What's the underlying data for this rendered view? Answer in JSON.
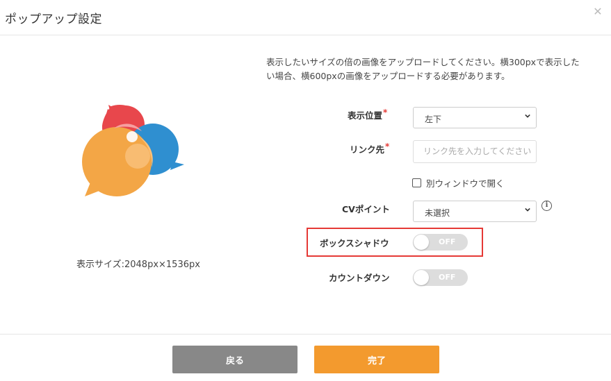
{
  "dialog": {
    "title": "ポップアップ設定",
    "close_icon": "close-icon"
  },
  "preview": {
    "size_text": "表示サイズ:2048px×1536px",
    "colors": {
      "red": "#e8474c",
      "blue": "#2f8fd0",
      "orange": "#f3a646",
      "overlap": "#f8c07a"
    }
  },
  "form": {
    "description": "表示したいサイズの倍の画像をアップロードしてください。横300pxで表示したい場合、横600pxの画像をアップロードする必要があります。",
    "required_mark": "*",
    "position": {
      "label": "表示位置",
      "value": "左下"
    },
    "link": {
      "label": "リンク先",
      "placeholder": "リンク先を入力してください"
    },
    "new_window": {
      "label": "別ウィンドウで開く",
      "checked": false
    },
    "cv_point": {
      "label": "CVポイント",
      "value": "未選択"
    },
    "box_shadow": {
      "label": "ボックスシャドウ",
      "state": "OFF"
    },
    "countdown": {
      "label": "カウントダウン",
      "state": "OFF"
    }
  },
  "footer": {
    "back_label": "戻る",
    "done_label": "完了"
  }
}
